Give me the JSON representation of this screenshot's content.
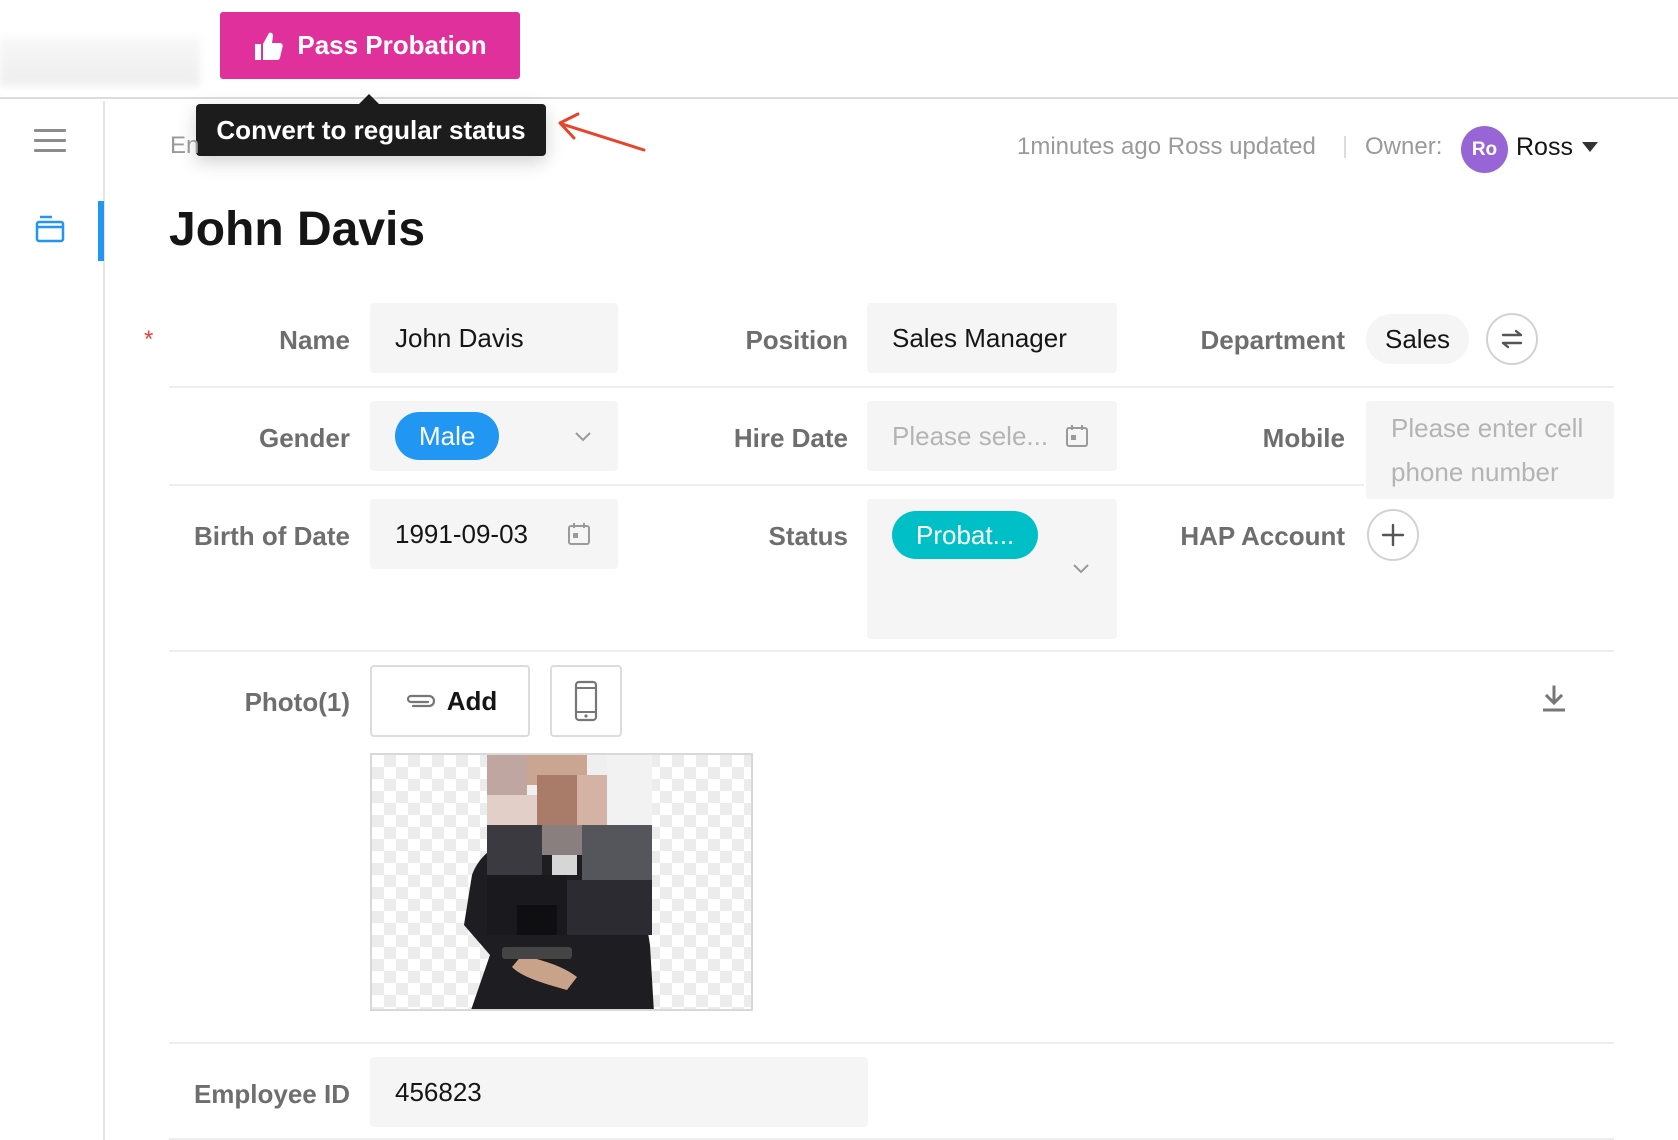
{
  "toolbar": {
    "pass_probation_label": "Pass Probation",
    "tooltip": "Convert to regular status"
  },
  "header": {
    "breadcrumb": "En",
    "updated": "1minutes ago Ross updated",
    "owner_label": "Owner:",
    "owner_initials": "Ro",
    "owner_name": "Ross"
  },
  "record": {
    "title": "John Davis"
  },
  "form": {
    "required_mark": "*",
    "name": {
      "label": "Name",
      "value": "John Davis"
    },
    "position": {
      "label": "Position",
      "value": "Sales Manager"
    },
    "department": {
      "label": "Department",
      "value": "Sales"
    },
    "gender": {
      "label": "Gender",
      "value": "Male"
    },
    "hire_date": {
      "label": "Hire Date",
      "placeholder": "Please sele..."
    },
    "mobile": {
      "label": "Mobile",
      "placeholder_line1": "Please enter cell",
      "placeholder_line2": "phone number"
    },
    "birth_date": {
      "label": "Birth of Date",
      "value": "1991-09-03"
    },
    "status": {
      "label": "Status",
      "value": "Probat..."
    },
    "hap_account": {
      "label": "HAP Account"
    },
    "photo": {
      "label": "Photo(1)",
      "add_label": "Add"
    },
    "employee_id": {
      "label": "Employee ID",
      "value": "456823"
    }
  },
  "colors": {
    "accent_pink": "#e0309c",
    "gender_pill": "#2196f3",
    "status_pill": "#00bfc7",
    "avatar": "#9765d6",
    "nav_active": "#2196f3"
  }
}
